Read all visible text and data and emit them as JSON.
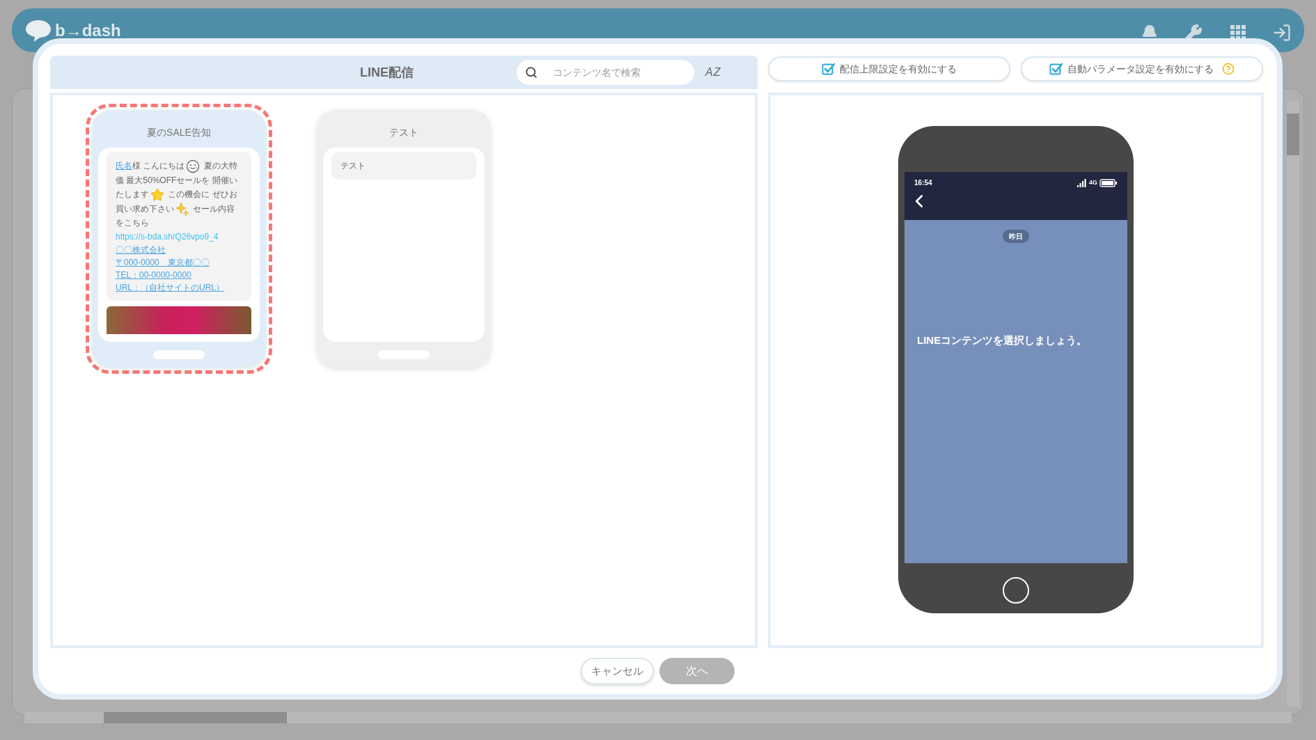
{
  "app_header": {
    "logo": "b→dash"
  },
  "modal": {
    "title": "LINE配信",
    "search": {
      "placeholder": "コンテンツ名で検索"
    },
    "sort_label": "AZ",
    "options": [
      {
        "label": "配信上限設定を有効にする",
        "checked": true,
        "help": false
      },
      {
        "label": "自動パラメータ設定を有効にする",
        "checked": true,
        "help": true
      }
    ],
    "cards": [
      {
        "title": "夏のSALE告知",
        "selected": true,
        "segments": [
          {
            "kind": "link",
            "text": "氏名"
          },
          {
            "kind": "text",
            "text": "様 こんにちは"
          },
          {
            "kind": "face"
          },
          {
            "kind": "text",
            "text": " 夏の大特価 最大50%OFFセールを 開催いたします"
          },
          {
            "kind": "star"
          },
          {
            "kind": "text",
            "text": " この機会に ぜひお買い求め下さい"
          },
          {
            "kind": "sparkle"
          },
          {
            "kind": "text",
            "text": " セール内容をこちら "
          },
          {
            "kind": "url",
            "text": "https://s-bda.sh/Q26vpo9_4"
          }
        ],
        "links": [
          "〇〇株式会社",
          "〒000-0000　東京都〇〇",
          "TEL：00-0000-0000",
          "URL：（自社サイトのURL）"
        ],
        "photo": true
      },
      {
        "title": "テスト",
        "selected": false,
        "segments": [
          {
            "kind": "text",
            "text": "テスト"
          }
        ],
        "photo": false
      }
    ],
    "preview": {
      "time": "16:54",
      "network": "4G",
      "date_chip": "昨日",
      "message": "LINEコンテンツを選択しましょう。"
    },
    "buttons": [
      {
        "label": "キャンセル",
        "disabled": false
      },
      {
        "label": "次へ",
        "disabled": true
      }
    ]
  }
}
